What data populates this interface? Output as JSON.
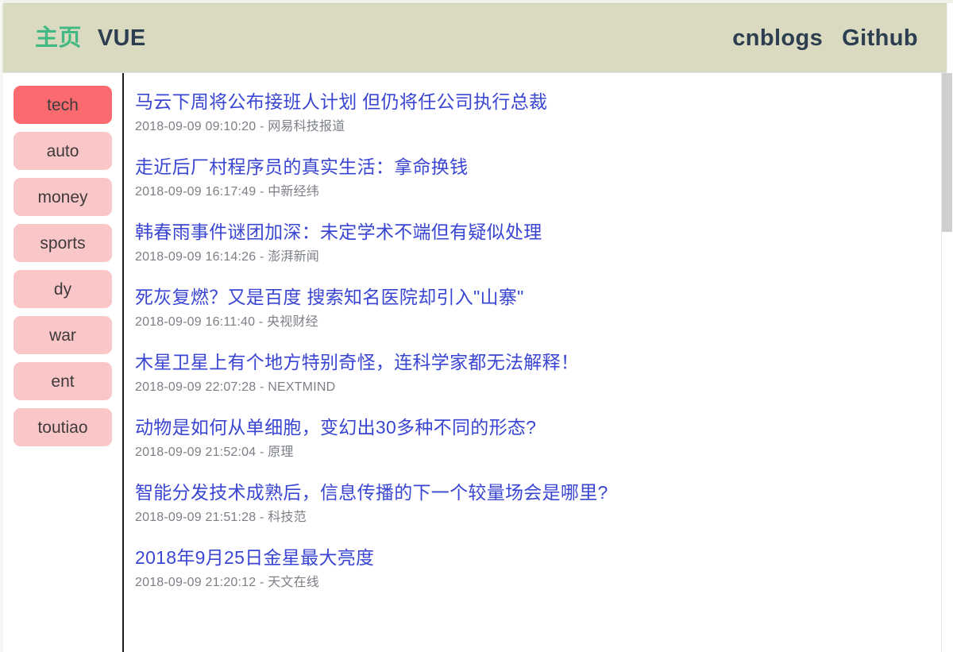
{
  "header": {
    "left_links": [
      {
        "label": "主页",
        "name": "nav-link-home",
        "style": "home"
      },
      {
        "label": "VUE",
        "name": "nav-link-vue",
        "style": "plain"
      }
    ],
    "right_links": [
      {
        "label": "cnblogs",
        "name": "nav-link-cnblogs"
      },
      {
        "label": "Github",
        "name": "nav-link-github"
      }
    ]
  },
  "sidebar": {
    "active_index": 0,
    "categories": [
      {
        "label": "tech",
        "active": true
      },
      {
        "label": "auto",
        "active": false
      },
      {
        "label": "money",
        "active": false
      },
      {
        "label": "sports",
        "active": false
      },
      {
        "label": "dy",
        "active": false
      },
      {
        "label": "war",
        "active": false
      },
      {
        "label": "ent",
        "active": false
      },
      {
        "label": "toutiao",
        "active": false
      }
    ]
  },
  "news": {
    "items": [
      {
        "title": "马云下周将公布接班人计划 但仍将任公司执行总裁",
        "time": "2018-09-09 09:10:20",
        "source": "网易科技报道",
        "meta": "2018-09-09 09:10:20 - 网易科技报道"
      },
      {
        "title": "走近后厂村程序员的真实生活：拿命换钱",
        "time": "2018-09-09 16:17:49",
        "source": "中新经纬",
        "meta": "2018-09-09 16:17:49 - 中新经纬"
      },
      {
        "title": "韩春雨事件谜团加深：未定学术不端但有疑似处理",
        "time": "2018-09-09 16:14:26",
        "source": "澎湃新闻",
        "meta": "2018-09-09 16:14:26 - 澎湃新闻"
      },
      {
        "title": "死灰复燃？又是百度 搜索知名医院却引入\"山寨\"",
        "time": "2018-09-09 16:11:40",
        "source": "央视财经",
        "meta": "2018-09-09 16:11:40 - 央视财经"
      },
      {
        "title": "木星卫星上有个地方特别奇怪，连科学家都无法解释！",
        "time": "2018-09-09 22:07:28",
        "source": "NEXTMIND",
        "meta": "2018-09-09 22:07:28 - NEXTMIND"
      },
      {
        "title": "动物是如何从单细胞，变幻出30多种不同的形态?",
        "time": "2018-09-09 21:52:04",
        "source": "原理",
        "meta": "2018-09-09 21:52:04 - 原理"
      },
      {
        "title": "智能分发技术成熟后，信息传播的下一个较量场会是哪里?",
        "time": "2018-09-09 21:51:28",
        "source": "科技范",
        "meta": "2018-09-09 21:51:28 - 科技范"
      },
      {
        "title": "2018年9月25日金星最大亮度",
        "time": "2018-09-09 21:20:12",
        "source": "天文在线",
        "meta": "2018-09-09 21:20:12 - 天文在线"
      }
    ]
  },
  "colors": {
    "header_bg": "#d9dac0",
    "accent_green": "#42b983",
    "link_blue": "#3a46d2",
    "category_active": "#fb6a6e",
    "category_inactive": "#fac7c9",
    "meta_gray": "#7b7f86",
    "divider": "#1c1c1c"
  },
  "scrollbar": {
    "orientation": "vertical",
    "thumb_position_percent": 0,
    "thumb_size_percent": 27
  }
}
